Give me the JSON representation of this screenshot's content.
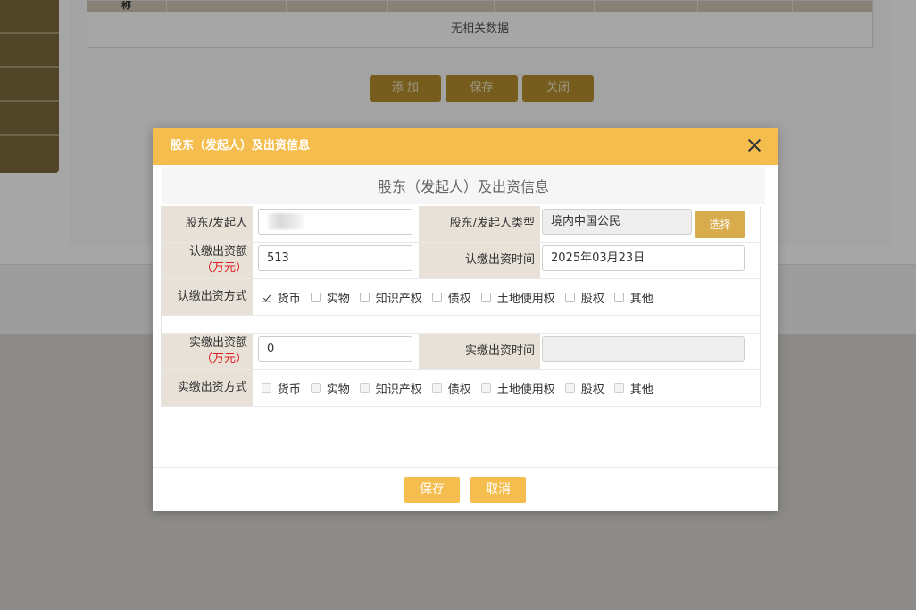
{
  "background": {
    "table_first_header": "称",
    "empty_text": "无相关数据",
    "buttons": [
      "添 加",
      "保存",
      "关闭"
    ]
  },
  "modal": {
    "title": "股东（发起人）及出资信息",
    "section_title": "股东（发起人）及出资信息",
    "shareholder_label": "股东/发起人",
    "shareholder_type_label": "股东/发起人类型",
    "shareholder_type_value": "境内中国公民",
    "select_button": "选择",
    "subscribed_amount_label": "认缴出资额",
    "subscribed_amount_unit": "（万元）",
    "subscribed_amount_value": "513",
    "subscribed_time_label": "认缴出资时间",
    "subscribed_time_value": "2025年03月23日",
    "subscribed_method_label": "认缴出资方式",
    "paid_amount_label": "实缴出资额",
    "paid_amount_unit": "（万元）",
    "paid_amount_value": "0",
    "paid_time_label": "实缴出资时间",
    "paid_time_value": "",
    "paid_method_label": "实缴出资方式",
    "methods": [
      "货币",
      "实物",
      "知识产权",
      "债权",
      "土地使用权",
      "股权",
      "其他"
    ],
    "subscribed_checked": [
      true,
      false,
      false,
      false,
      false,
      false,
      false
    ],
    "paid_checked": [
      false,
      false,
      false,
      false,
      false,
      false,
      false
    ],
    "save": "保存",
    "cancel": "取消"
  },
  "colors": {
    "header": "#f5bd4e",
    "label_bg": "#e8e1d8",
    "select_button": "#d8ac4c",
    "unit_red": "#e02020"
  }
}
